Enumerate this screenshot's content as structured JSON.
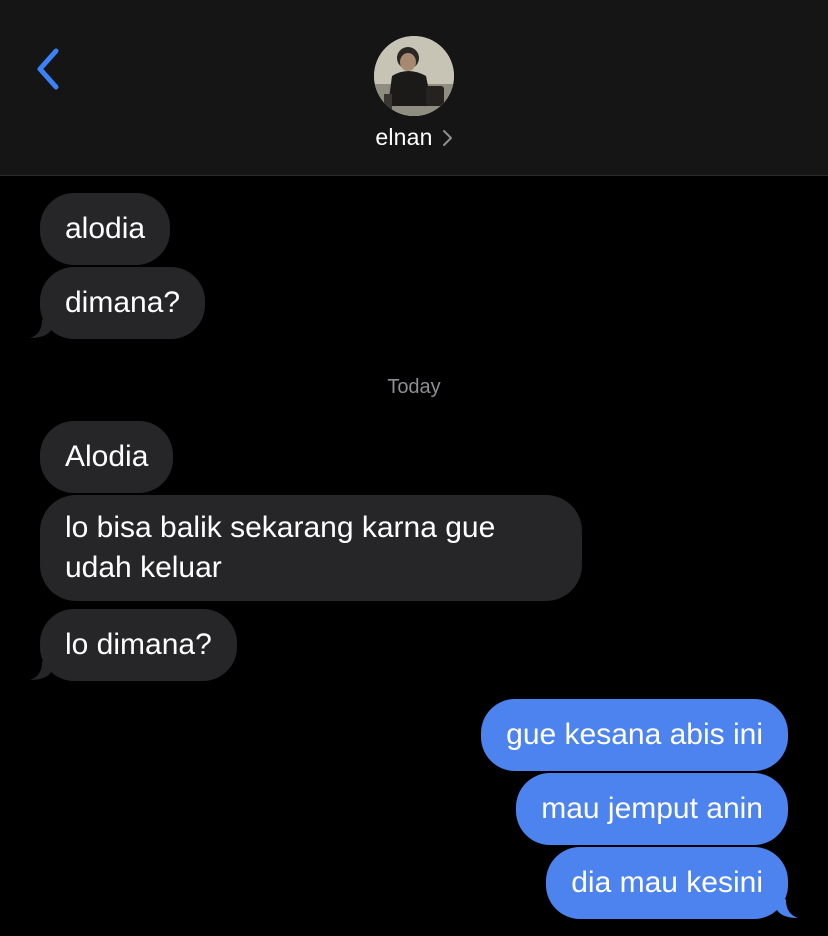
{
  "header": {
    "back_icon": "chevron-left-icon",
    "contact_name": "elnan",
    "contact_chevron_icon": "chevron-right-icon",
    "accent_color": "#3a82f6"
  },
  "messages": {
    "group1": [
      {
        "from": "them",
        "text": "alodia"
      },
      {
        "from": "them",
        "text": "dimana?"
      }
    ],
    "timestamp": "Today",
    "group2": [
      {
        "from": "them",
        "text": "Alodia"
      },
      {
        "from": "them",
        "text": "lo bisa balik sekarang karna gue udah keluar"
      },
      {
        "from": "them",
        "text": "lo dimana?"
      }
    ],
    "group3": [
      {
        "from": "me",
        "text": "gue kesana abis ini"
      },
      {
        "from": "me",
        "text": "mau jemput anin"
      },
      {
        "from": "me",
        "text": "dia mau kesini"
      }
    ]
  },
  "colors": {
    "incoming_bubble": "#262628",
    "outgoing_bubble": "#4d83ef",
    "background": "#000000"
  }
}
